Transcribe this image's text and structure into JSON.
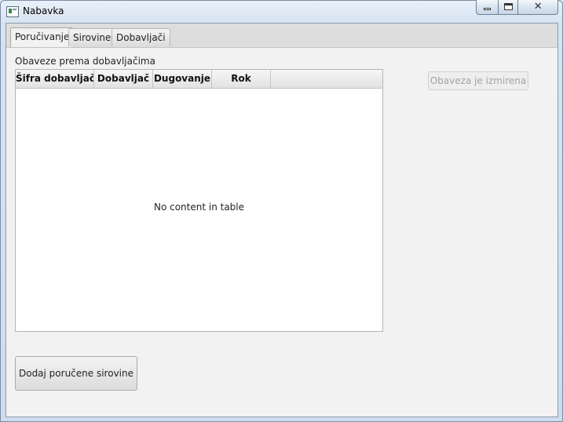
{
  "window": {
    "title": "Nabavka",
    "icon": "app-window-icon",
    "controls": {
      "minimize": "minimize-icon",
      "maximize": "maximize-icon",
      "close": "close-icon",
      "close_glyph": "✕"
    }
  },
  "tabs": [
    {
      "label": "Poručivanje",
      "active": true
    },
    {
      "label": "Sirovine",
      "active": false
    },
    {
      "label": "Dobavljači",
      "active": false
    }
  ],
  "main": {
    "section_label": "Obaveze prema dobavljačima",
    "table": {
      "columns": [
        "Šifra dobavljača",
        "Dobavljač",
        "Dugovanje",
        "Rok"
      ],
      "rows": [],
      "empty_message": "No content in table"
    },
    "obligation_button_label": "Obaveza je izmirena",
    "obligation_button_enabled": false,
    "add_button_label": "Dodaj poručene sirovine"
  }
}
